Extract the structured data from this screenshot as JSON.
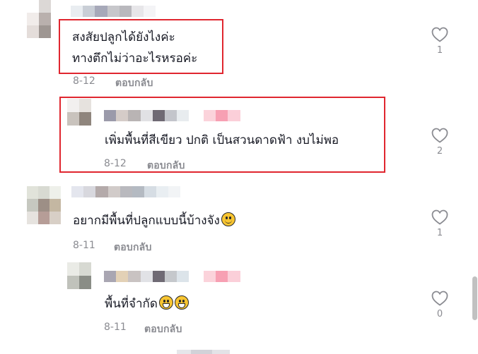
{
  "comments": [
    {
      "text_lines": [
        "สงสัยปลูกได้ยังไงค่ะ",
        "ทางตึกไม่ว่าอะไรหรอค่ะ"
      ],
      "date": "8-12",
      "reply_label": "ตอบกลับ",
      "likes": "1"
    },
    {
      "text": "เพิ่มพื้นที่สีเขียว ปกติ เป็นสวนดาดฟ้า งบไม่พอ",
      "date": "8-12",
      "reply_label": "ตอบกลับ",
      "likes": "2"
    },
    {
      "text": "อยากมีพื้นที่ปลูกแบบนี้บ้างจัง",
      "emoji": "smiling-face-emoji",
      "date": "8-11",
      "reply_label": "ตอบกลับ",
      "likes": "1"
    },
    {
      "text": "พื้นที่จำกัด",
      "emoji": "grinning-face-emoji",
      "date": "8-11",
      "reply_label": "ตอบกลับ",
      "likes": "0"
    }
  ],
  "colors": {
    "highlight_border": "#e0262f",
    "meta_text": "#8a8b91",
    "body_text": "#161823",
    "emoji_yellow": "#f8c531",
    "scrollbar": "#c1c1c1"
  },
  "icons": [
    "heart-outline-icon",
    "smiling-face-emoji",
    "grinning-face-emoji"
  ]
}
